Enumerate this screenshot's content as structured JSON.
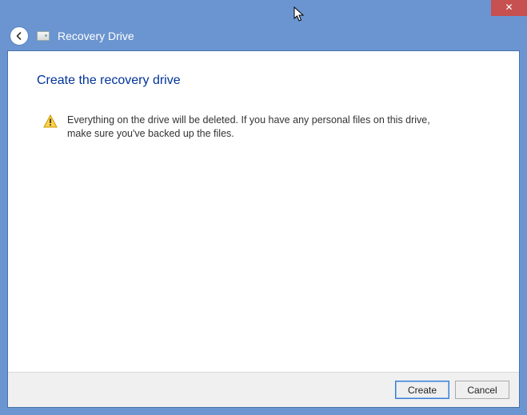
{
  "window": {
    "title": "Recovery Drive",
    "close_glyph": "✕"
  },
  "page": {
    "heading": "Create the recovery drive",
    "warning": "Everything on the drive will be deleted. If you have any personal files on this drive, make sure you've backed up the files."
  },
  "buttons": {
    "primary": "Create",
    "cancel": "Cancel"
  }
}
